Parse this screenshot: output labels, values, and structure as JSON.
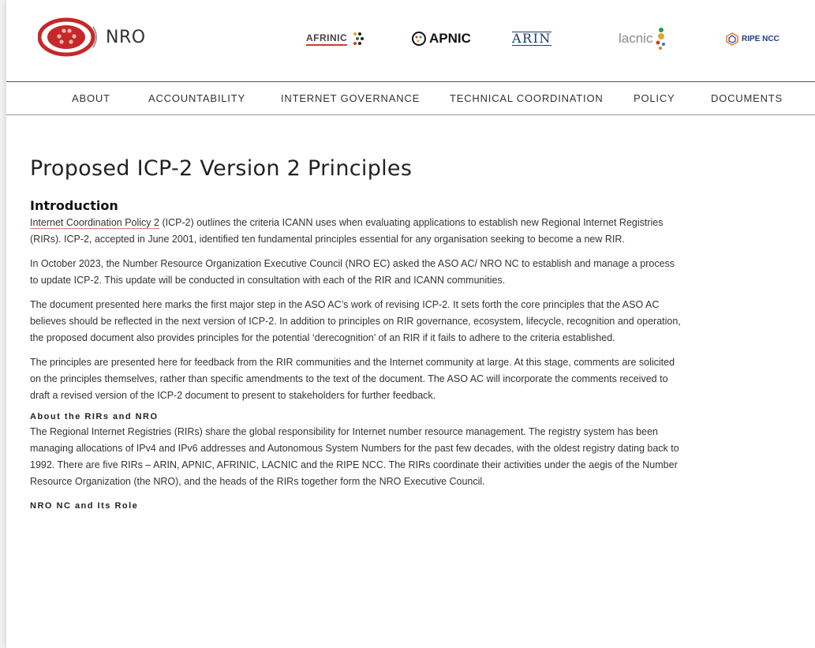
{
  "header": {
    "logo_text": "NRO",
    "rirs": [
      {
        "name": "AFRINIC"
      },
      {
        "name": "APNIC"
      },
      {
        "name": "ARIN"
      },
      {
        "name": "lacnic"
      },
      {
        "name": "RIPE NCC"
      }
    ]
  },
  "nav": {
    "items": [
      "ABOUT",
      "ACCOUNTABILITY",
      "INTERNET GOVERNANCE",
      "TECHNICAL COORDINATION",
      "POLICY",
      "DOCUMENTS"
    ]
  },
  "main": {
    "title": "Proposed ICP-2 Version 2 Principles",
    "intro_heading": "Introduction",
    "intro_link": "Internet Coordination Policy 2",
    "intro_p1_rest": " (ICP-2) outlines the criteria ICANN uses when evaluating applications to establish new Regional Internet Registries (RIRs). ICP-2, accepted in June 2001, identified ten fundamental principles essential for any organisation seeking to become a new RIR.",
    "p2": "In October 2023, the Number Resource Organization Executive Council (NRO EC) asked the ASO AC/ NRO NC to establish and manage a process to update ICP-2. This update will be conducted in consultation with each of the RIR and ICANN communities.",
    "p3": "The document presented here marks the first major step in the ASO AC’s work of revising ICP-2. It sets forth the core principles that the ASO AC believes should be reflected in the next version of ICP-2. In addition to principles on RIR governance, ecosystem, lifecycle, recognition and operation, the proposed document also provides principles for the potential ‘derecognition’ of an RIR if it fails to adhere to the criteria established.",
    "p4": "The principles are presented here for feedback from the RIR communities and the Internet community at large. At this stage, comments are solicited on the principles themselves, rather than specific amendments to the text of the document. The ASO AC will incorporate the comments received to draft a revised version of the ICP-2 document to present to stakeholders for further feedback.",
    "about_heading": "About the RIRs and NRO",
    "p5": "The Regional Internet Registries (RIRs) share the global responsibility for Internet number resource management. The registry system has been managing allocations of IPv4 and IPv6 addresses and Autonomous System Numbers for the past few decades, with the oldest registry dating back to 1992. There are five RIRs – ARIN, APNIC, AFRINIC, LACNIC and the RIPE NCC. The RIRs coordinate their activities under the aegis of the Number Resource Organization (the NRO), and the heads of the RIRs together form the NRO Executive Council.",
    "nc_heading": "NRO NC and Its Role"
  },
  "colors": {
    "nro_red": "#c62828",
    "link_underline": "#e07a7a"
  }
}
